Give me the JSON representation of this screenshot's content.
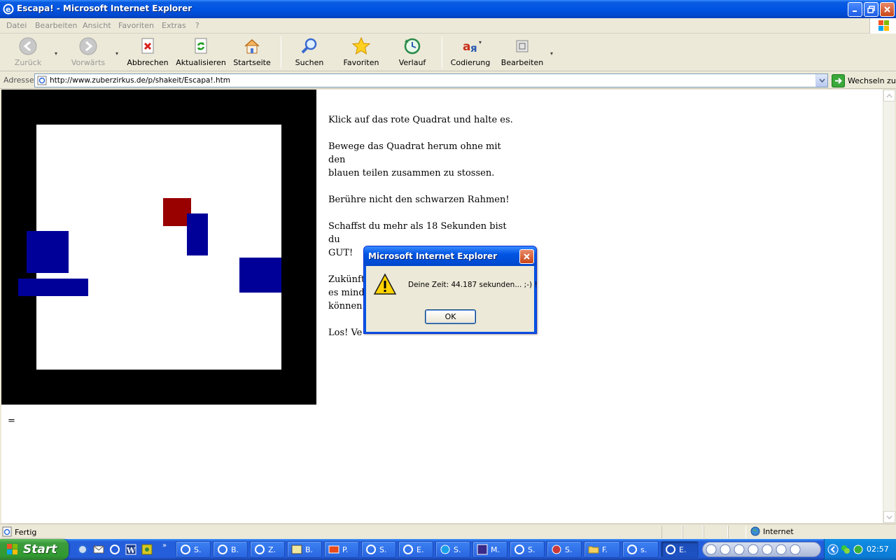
{
  "window": {
    "title": "Escapa! - Microsoft Internet Explorer"
  },
  "menu": [
    "Datei",
    "Bearbeiten",
    "Ansicht",
    "Favoriten",
    "Extras",
    "?"
  ],
  "toolbar": {
    "back": "Zurück",
    "forward": "Vorwärts",
    "stop": "Abbrechen",
    "refresh": "Aktualisieren",
    "home": "Startseite",
    "search": "Suchen",
    "favorites": "Favoriten",
    "history": "Verlauf",
    "encoding": "Codierung",
    "edit": "Bearbeiten"
  },
  "address": {
    "label": "Adresse",
    "url": "http://www.zuberzirkus.de/p/shakeit/Escapa!.htm",
    "go": "Wechseln zu"
  },
  "page": {
    "instructions": [
      "Klick auf das rote Quadrat und halte es.",
      "Bewege das Quadrat herum ohne mit den\nblauen teilen zusammen zu stossen.",
      "Berühre nicht den schwarzen Rahmen!",
      "Schaffst du mehr als 18 Sekunden bist du\nGUT!",
      "Zukünfti\nes minde\nkönnen.",
      "Los! Ve"
    ],
    "footer_symbol": "=",
    "colors": {
      "red": "#990000",
      "blue": "#000099",
      "frame": "#000000"
    }
  },
  "dialog": {
    "title": "Microsoft Internet Explorer",
    "message": "Deine Zeit: 44.187 sekunden... ;-) !",
    "ok": "OK"
  },
  "status": {
    "text": "Fertig",
    "zone": "Internet"
  },
  "taskbar": {
    "start": "Start",
    "tasks": [
      "S.",
      "B.",
      "Z.",
      "B.",
      "P.",
      "S.",
      "E.",
      "S.",
      "M.",
      "S.",
      "S.",
      "F.",
      "s.",
      "E."
    ],
    "clock": "02:57"
  }
}
